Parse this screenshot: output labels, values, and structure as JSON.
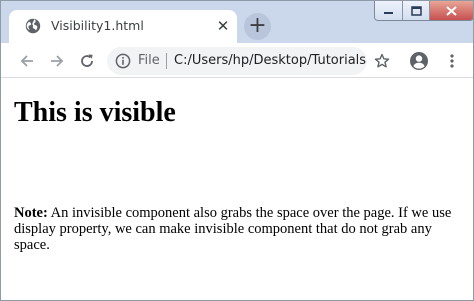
{
  "browser": {
    "tab": {
      "title": "Visibility1.html",
      "close_glyph": "✕",
      "favicon": "globe-icon"
    },
    "new_tab_glyph": "+",
    "window_controls": [
      "minimize-icon",
      "restore-icon",
      "close-icon"
    ],
    "nav_icons": [
      "back-arrow-icon",
      "forward-arrow-icon",
      "reload-icon"
    ],
    "address_bar": {
      "scheme_label": "File",
      "url": "C:/Users/hp/Desktop/Tutorials..."
    },
    "toolbar_icons": [
      "star-icon",
      "account-icon",
      "menu-icon"
    ],
    "colors": {
      "tab_strip": "#cbd7ea",
      "omnibox": "#f1f3f4",
      "close_button": "#c75050"
    }
  },
  "page": {
    "heading": "This is visible",
    "note_label": "Note:",
    "note_text": " An invisible component also grabs the space over the page. If we use display property, we can make invisible component that do not grab any space."
  }
}
